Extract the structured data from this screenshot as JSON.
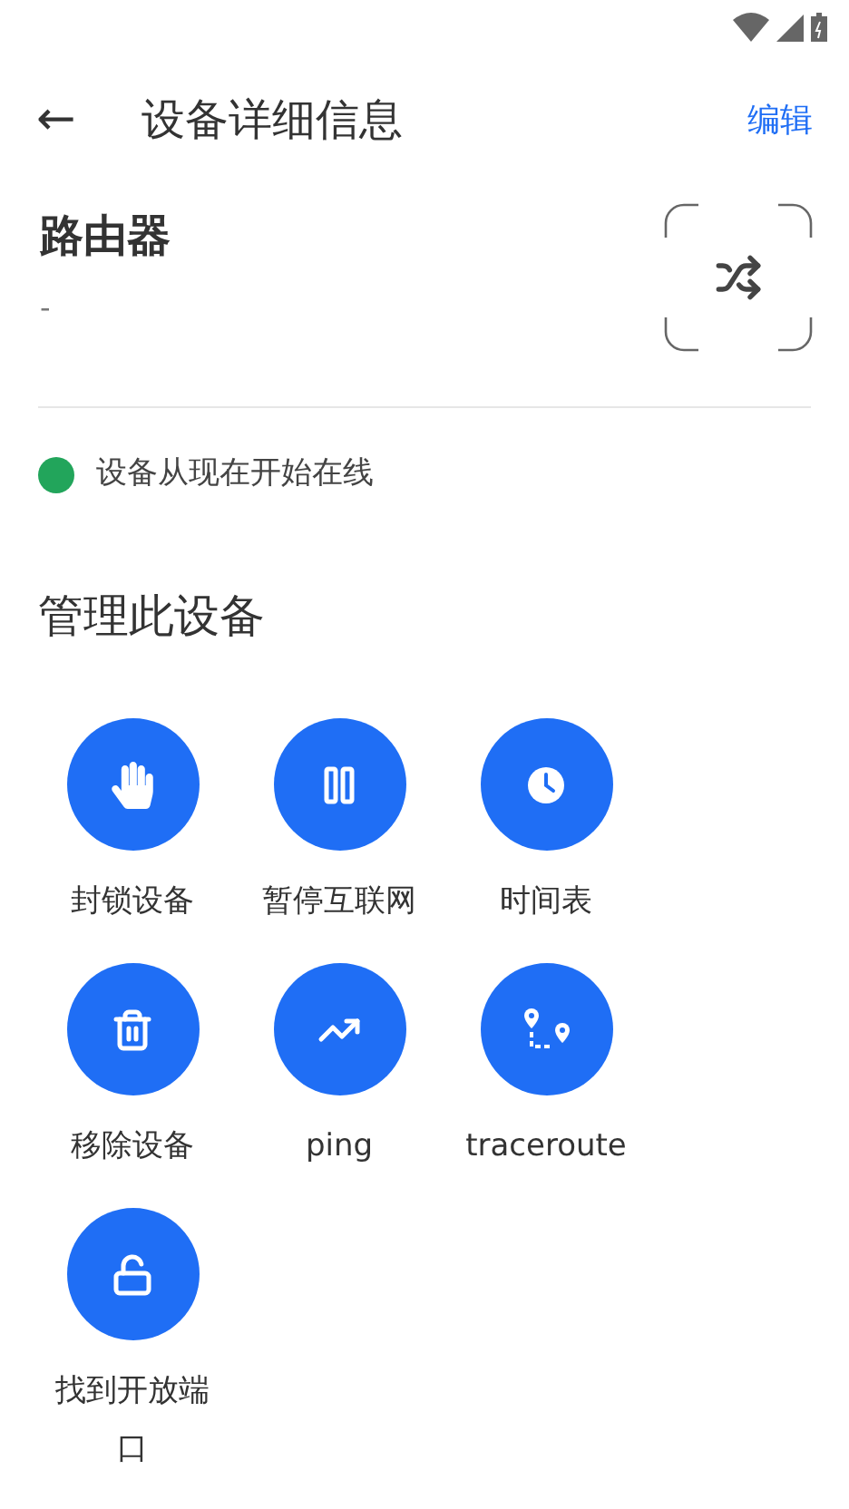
{
  "header": {
    "back": "←",
    "title": "设备详细信息",
    "action": "编辑"
  },
  "device": {
    "name": "路由器",
    "subtitle": "-"
  },
  "status": {
    "text": "设备从现在开始在线",
    "color": "#22a55b"
  },
  "section_title": "管理此设备",
  "actions": [
    {
      "kind": "block",
      "label": "封锁设备"
    },
    {
      "kind": "pause",
      "label": "暂停互联网"
    },
    {
      "kind": "schedule",
      "label": "时间表"
    },
    {
      "kind": "remove",
      "label": "移除设备"
    },
    {
      "kind": "ping",
      "label": "ping"
    },
    {
      "kind": "traceroute",
      "label": "traceroute"
    },
    {
      "kind": "ports",
      "label": "找到开放端口"
    }
  ]
}
